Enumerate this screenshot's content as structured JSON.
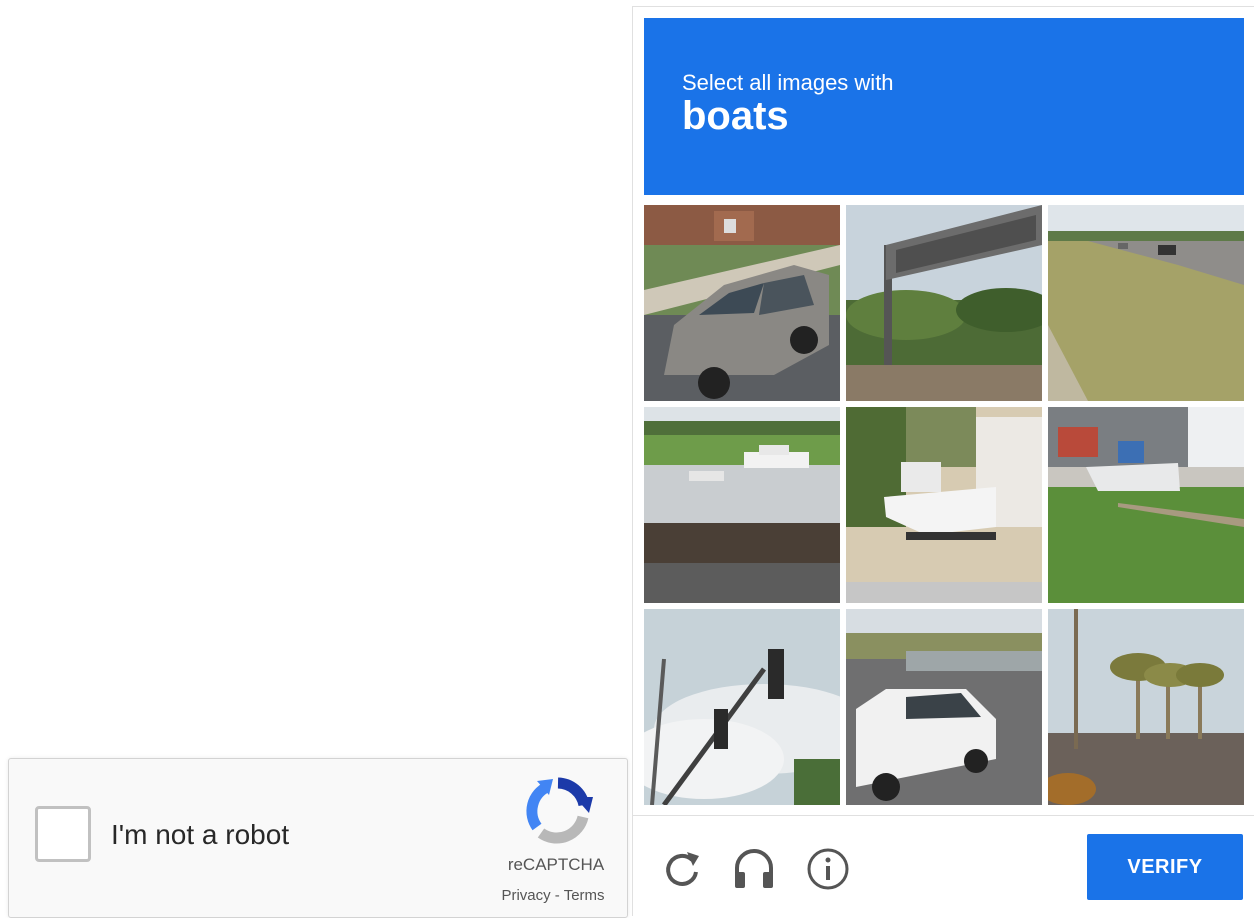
{
  "checkbox_widget": {
    "label": "I'm not a robot",
    "brand": "reCAPTCHA",
    "privacy_link": "Privacy",
    "separator": " - ",
    "terms_link": "Terms"
  },
  "challenge": {
    "prompt": "Select all images with",
    "target": "boats",
    "verify_button": "VERIFY",
    "footer_icons": [
      "reload-icon",
      "audio-headphones-icon",
      "info-icon"
    ],
    "tiles": [
      "grey SUV parked on a residential street",
      "highway overhead sign above trees",
      "highway with cars and dry grass",
      "boats on a river with a green shore",
      "white motorboat on a trailer in a yard",
      "white boat on a trailer on a lawn",
      "traffic lights against a cloudy sky",
      "white van on a road",
      "palm trees beside a wall"
    ]
  },
  "colors": {
    "accent": "#1a73e8"
  }
}
